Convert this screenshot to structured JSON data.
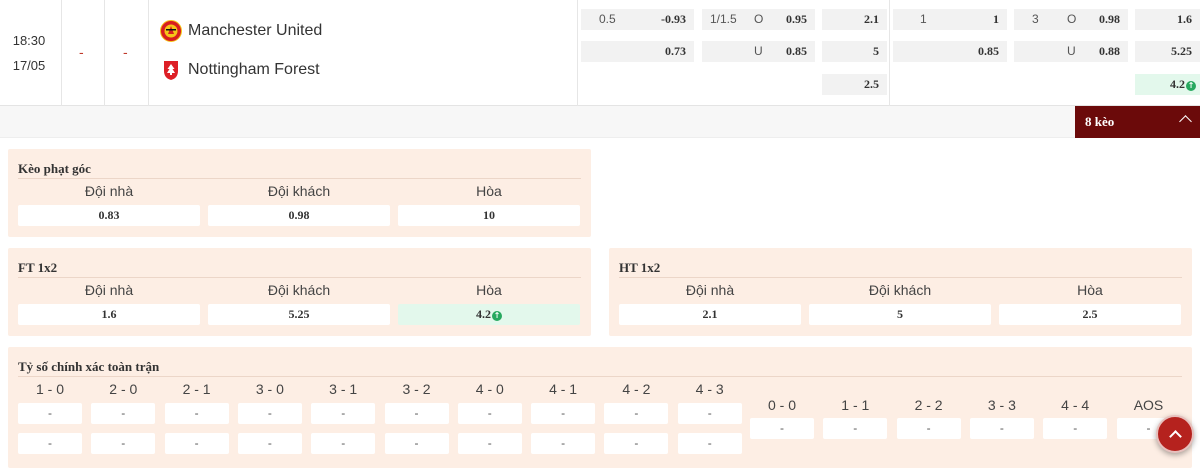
{
  "match": {
    "time": "18:30",
    "date": "17/05",
    "home_dash": "-",
    "away_dash": "-",
    "home_team": "Manchester United",
    "away_team": "Nottingham Forest",
    "home_crest_icon": "man-utd-crest-icon",
    "away_crest_icon": "nottingham-forest-crest-icon"
  },
  "odds": {
    "ft_handicap": {
      "line": "0.5",
      "home": "-0.93",
      "away": "0.73"
    },
    "ft_ou": {
      "line": "1/1.5",
      "over_label": "O",
      "over": "0.95",
      "under_label": "U",
      "under": "0.85"
    },
    "ft_1x2": {
      "home": "2.1",
      "away": "5",
      "draw": "2.5"
    },
    "ht_handicap": {
      "line": "1",
      "home": "1",
      "away": "0.85"
    },
    "ht_ou": {
      "line": "3",
      "over_label": "O",
      "over": "0.98",
      "under_label": "U",
      "under": "0.88"
    },
    "ht_1x2": {
      "home": "1.6",
      "away": "5.25",
      "draw": "4.2"
    }
  },
  "more_button": {
    "label": "8 kèo"
  },
  "corner_panel": {
    "title": "Kèo phạt góc",
    "headers": [
      "Đội nhà",
      "Đội khách",
      "Hòa"
    ],
    "values": [
      "0.83",
      "0.98",
      "10"
    ]
  },
  "ft_panel": {
    "title": "FT 1x2",
    "headers": [
      "Đội nhà",
      "Đội khách",
      "Hòa"
    ],
    "values": [
      "1.6",
      "5.25",
      "4.2"
    ]
  },
  "ht_panel": {
    "title": "HT 1x2",
    "headers": [
      "Đội nhà",
      "Đội khách",
      "Hòa"
    ],
    "values": [
      "2.1",
      "5",
      "2.5"
    ]
  },
  "score_panel": {
    "title": "Tỷ số chính xác toàn trận",
    "home_scores": [
      "1 - 0",
      "2 - 0",
      "2 - 1",
      "3 - 0",
      "3 - 1",
      "3 - 2",
      "4 - 0",
      "4 - 1",
      "4 - 2",
      "4 - 3"
    ],
    "draw_scores": [
      "0 - 0",
      "1 - 1",
      "2 - 2",
      "3 - 3",
      "4 - 4",
      "AOS"
    ],
    "empty": "-"
  },
  "colors": {
    "accent": "#6b0a0a",
    "panel": "#fdeee4",
    "up": "#27a85f",
    "scroll_button": "#b5221e"
  }
}
